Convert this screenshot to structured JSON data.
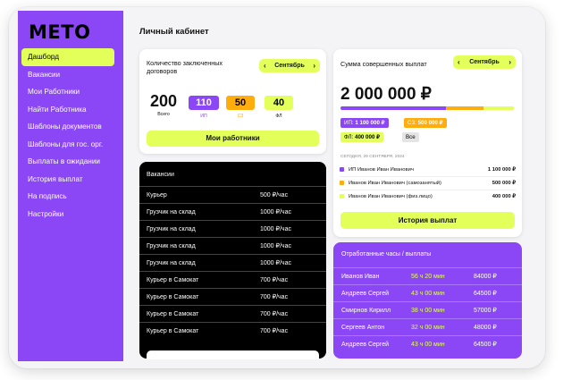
{
  "logo": "METO",
  "sidebar": {
    "items": [
      {
        "label": "Дашборд",
        "active": true
      },
      {
        "label": "Вакансии"
      },
      {
        "label": "Мои Работники"
      },
      {
        "label": "Найти Работника"
      },
      {
        "label": "Шаблоны документов"
      },
      {
        "label": "Шаблоны для гос. орг."
      },
      {
        "label": "Выплаты в ожидании"
      },
      {
        "label": "История выплат"
      },
      {
        "label": "На подпись"
      },
      {
        "label": "Настройки"
      }
    ]
  },
  "page_title": "Личный кабинет",
  "contracts": {
    "title": "Количество заключенных договоров",
    "month": "Сентябрь",
    "total": "200",
    "total_label": "Всего",
    "ip": "110",
    "ip_label": "ИП",
    "sz": "50",
    "sz_label": "СЗ",
    "fl": "40",
    "fl_label": "ФЛ",
    "button": "Мои работники"
  },
  "payouts": {
    "title": "Сумма совершенных выплат",
    "month": "Сентябрь",
    "total": "2 000 000 ₽",
    "chips": {
      "ip_label": "ИП:",
      "ip_value": "1 100 000 ₽",
      "sz_label": "СЗ:",
      "sz_value": "500 000 ₽",
      "fl_label": "ФЛ:",
      "fl_value": "400 000 ₽",
      "all": "Все"
    },
    "date": "СЕГОДНЯ, 29 СЕНТЯБРЯ, 2024",
    "rows": [
      {
        "name": "ИП Иванов Иван Иванович",
        "sum": "1 100 000 ₽"
      },
      {
        "name": "Иванов Иван Иванович (самозанятый)",
        "sum": "500 000 ₽"
      },
      {
        "name": "Иванов Иван Иванович (физ.лицо)",
        "sum": "400 000 ₽"
      }
    ],
    "button": "История выплат"
  },
  "vacancies": {
    "title": "Вакансии",
    "rows": [
      {
        "name": "Курьер",
        "rate": "500 ₽/час"
      },
      {
        "name": "Грузчик на склад",
        "rate": "1000 ₽/час"
      },
      {
        "name": "Грузчик на склад",
        "rate": "1000 ₽/час"
      },
      {
        "name": "Грузчик на склад",
        "rate": "1000 ₽/час"
      },
      {
        "name": "Грузчик на склад",
        "rate": "1000 ₽/час"
      },
      {
        "name": "Курьер в Самокат",
        "rate": "700 ₽/час"
      },
      {
        "name": "Курьер в Самокат",
        "rate": "700 ₽/час"
      },
      {
        "name": "Курьер в Самокат",
        "rate": "700 ₽/час"
      },
      {
        "name": "Курьер в Самокат",
        "rate": "700 ₽/час"
      }
    ]
  },
  "hours": {
    "title": "Отработанные часы / выплаты",
    "rows": [
      {
        "name": "Иванов Иван",
        "time": "56 ч 20 мин",
        "sum": "84000 ₽"
      },
      {
        "name": "Андреев Сергей",
        "time": "43 ч 00 мин",
        "sum": "64500 ₽"
      },
      {
        "name": "Смирнов Кирилл",
        "time": "38 ч 00 мин",
        "sum": "57000 ₽"
      },
      {
        "name": "Сергеев Антон",
        "time": "32 ч 00 мин",
        "sum": "48000 ₽"
      },
      {
        "name": "Андреев Сергей",
        "time": "43 ч 00 мин",
        "sum": "64500 ₽"
      }
    ]
  },
  "colors": {
    "purple": "#8b47f6",
    "lime": "#e2ff5a",
    "orange": "#ffad0d",
    "black": "#000000"
  }
}
